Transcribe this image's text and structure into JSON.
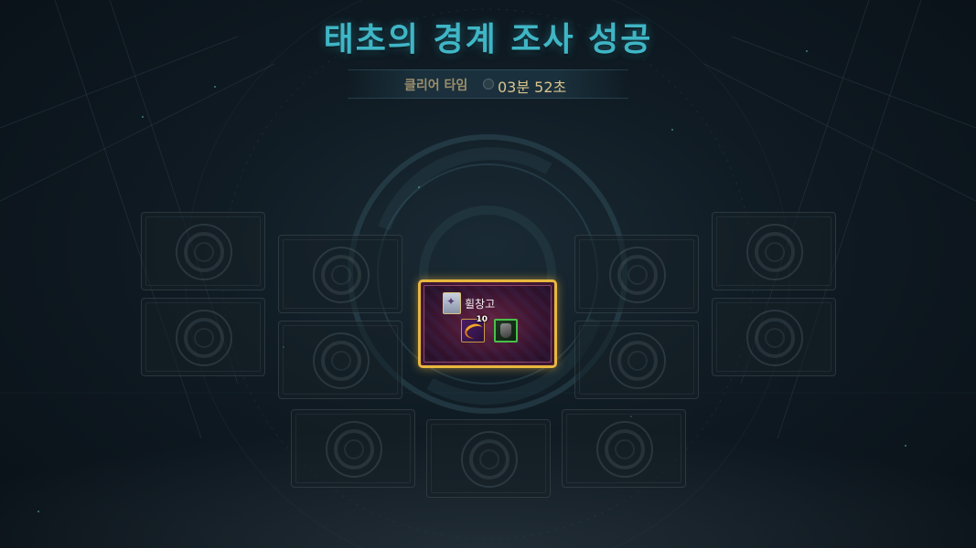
{
  "result": {
    "title": "태초의 경계 조사 성공",
    "clear_time_label": "클리어 타임",
    "clear_time_value": "03분 52초"
  },
  "reward": {
    "player_name": "휠창고",
    "player_icon": "character-portrait-icon",
    "items": [
      {
        "icon": "crescent-blade-icon",
        "count": "10",
        "rarity_color": "#c39a48"
      },
      {
        "icon": "armor-chest-icon",
        "rarity_color": "#49c04a"
      }
    ]
  },
  "empty_slots": 12,
  "colors": {
    "title": "#3fb6c6",
    "time_value": "#d9c38e",
    "reward_border": "#e8b83e"
  }
}
